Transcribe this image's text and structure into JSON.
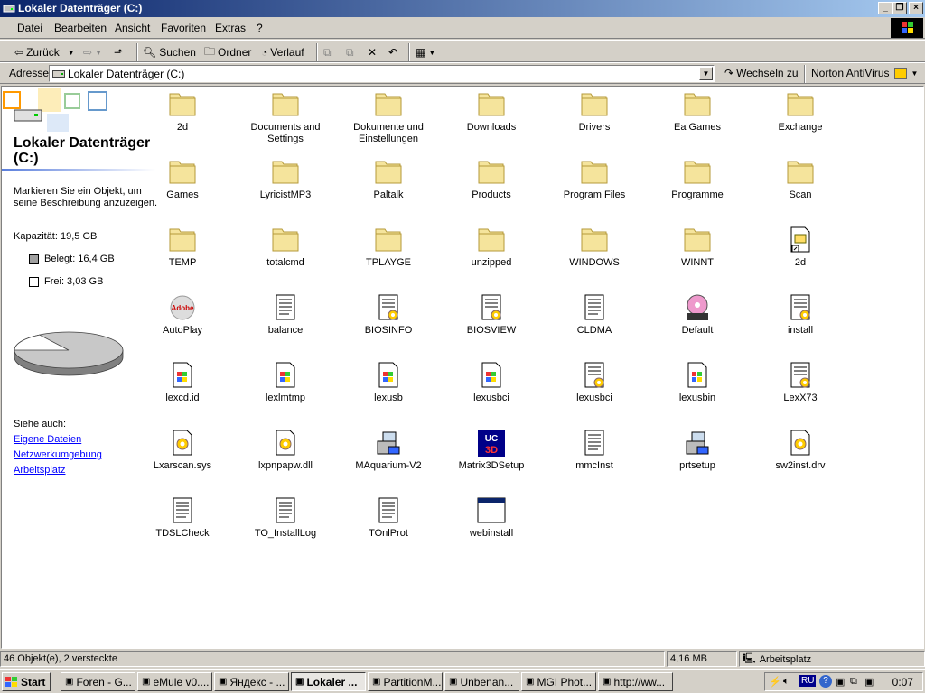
{
  "window": {
    "title": "Lokaler Datenträger (C:)"
  },
  "menu": [
    "Datei",
    "Bearbeiten",
    "Ansicht",
    "Favoriten",
    "Extras",
    "?"
  ],
  "toolbar": {
    "back": "Zurück",
    "search": "Suchen",
    "folders": "Ordner",
    "history": "Verlauf"
  },
  "address": {
    "label": "Adresse",
    "value": "Lokaler Datenträger (C:)",
    "go": "Wechseln zu",
    "norton": "Norton AntiVirus"
  },
  "left": {
    "title": "Lokaler Datenträger (C:)",
    "description": "Markieren Sie ein Objekt, um seine Beschreibung anzuzeigen.",
    "capacity": "Kapazität: 19,5 GB",
    "used": "Belegt: 16,4 GB",
    "free": "Frei: 3,03 GB",
    "used_fraction": 0.84,
    "see_also": "Siehe auch:",
    "links": [
      "Eigene Dateien",
      "Netzwerkumgebung",
      "Arbeitsplatz"
    ]
  },
  "items": [
    {
      "name": "2d",
      "type": "folder"
    },
    {
      "name": "Documents and Settings",
      "type": "folder"
    },
    {
      "name": "Dokumente und Einstellungen",
      "type": "folder"
    },
    {
      "name": "Downloads",
      "type": "folder"
    },
    {
      "name": "Drivers",
      "type": "folder"
    },
    {
      "name": "Ea Games",
      "type": "folder"
    },
    {
      "name": "Exchange",
      "type": "folder"
    },
    {
      "name": "Games",
      "type": "folder"
    },
    {
      "name": "LyricistMP3",
      "type": "folder"
    },
    {
      "name": "Paltalk",
      "type": "folder"
    },
    {
      "name": "Products",
      "type": "folder"
    },
    {
      "name": "Program Files",
      "type": "folder"
    },
    {
      "name": "Programme",
      "type": "folder"
    },
    {
      "name": "Scan",
      "type": "folder"
    },
    {
      "name": "TEMP",
      "type": "folder"
    },
    {
      "name": "totalcmd",
      "type": "folder"
    },
    {
      "name": "TPLAYGE",
      "type": "folder"
    },
    {
      "name": "unzipped",
      "type": "folder"
    },
    {
      "name": "WINDOWS",
      "type": "folder"
    },
    {
      "name": "WINNT",
      "type": "folder"
    },
    {
      "name": "2d",
      "type": "shortcut"
    },
    {
      "name": "AutoPlay",
      "type": "adobe"
    },
    {
      "name": "balance",
      "type": "text"
    },
    {
      "name": "BIOSINFO",
      "type": "config"
    },
    {
      "name": "BIOSVIEW",
      "type": "config"
    },
    {
      "name": "CLDMA",
      "type": "text"
    },
    {
      "name": "Default",
      "type": "media"
    },
    {
      "name": "install",
      "type": "config"
    },
    {
      "name": "lexcd.id",
      "type": "winfile"
    },
    {
      "name": "lexlmtmp",
      "type": "winfile"
    },
    {
      "name": "lexusb",
      "type": "winfile"
    },
    {
      "name": "lexusbci",
      "type": "winfile"
    },
    {
      "name": "lexusbci",
      "type": "config"
    },
    {
      "name": "lexusbin",
      "type": "winfile"
    },
    {
      "name": "LexX73",
      "type": "config"
    },
    {
      "name": "Lxarscan.sys",
      "type": "system"
    },
    {
      "name": "lxpnpapw.dll",
      "type": "system"
    },
    {
      "name": "MAquarium-V2",
      "type": "setup"
    },
    {
      "name": "Matrix3DSetup",
      "type": "matrix"
    },
    {
      "name": "mmcInst",
      "type": "text"
    },
    {
      "name": "prtsetup",
      "type": "setup"
    },
    {
      "name": "sw2inst.drv",
      "type": "system"
    },
    {
      "name": "TDSLCheck",
      "type": "text"
    },
    {
      "name": "TO_InstallLog",
      "type": "text"
    },
    {
      "name": "TOnlProt",
      "type": "text"
    },
    {
      "name": "webinstall",
      "type": "window"
    }
  ],
  "status": {
    "count": "46 Objekt(e), 2 versteckte",
    "size": "4,16 MB",
    "location": "Arbeitsplatz"
  },
  "taskbar": {
    "start": "Start",
    "tasks": [
      {
        "label": "Foren - G...",
        "active": false
      },
      {
        "label": "eMule v0....",
        "active": false
      },
      {
        "label": "Яндекс - ...",
        "active": false
      },
      {
        "label": "Lokaler ...",
        "active": true
      },
      {
        "label": "PartitionM...",
        "active": false
      },
      {
        "label": "Unbenan...",
        "active": false
      },
      {
        "label": "MGI Phot...",
        "active": false
      },
      {
        "label": "http://ww...",
        "active": false
      }
    ],
    "lang": "RU",
    "clock": "0:07"
  },
  "colors": {
    "title_start": "#0a246a",
    "title_end": "#a6caf0",
    "folder": "#f5e49c",
    "link": "#0000ff",
    "used_swatch": "#a0a0a0"
  }
}
